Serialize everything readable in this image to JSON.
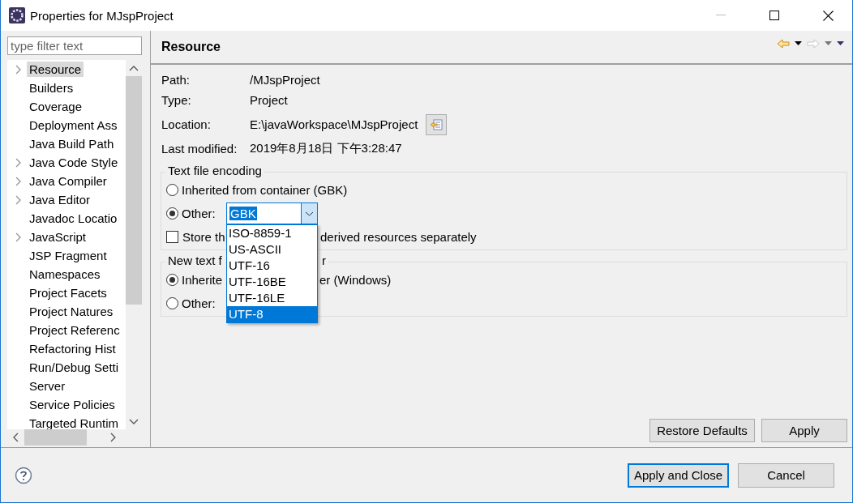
{
  "window": {
    "title": "Properties for MJspProject"
  },
  "filter": {
    "placeholder": "type filter text"
  },
  "tree": {
    "items": [
      {
        "label": "Resource",
        "expandable": true,
        "selected": true
      },
      {
        "label": "Builders",
        "expandable": false,
        "selected": false
      },
      {
        "label": "Coverage",
        "expandable": false,
        "selected": false
      },
      {
        "label": "Deployment Ass",
        "expandable": false,
        "selected": false
      },
      {
        "label": "Java Build Path",
        "expandable": false,
        "selected": false
      },
      {
        "label": "Java Code Style",
        "expandable": true,
        "selected": false
      },
      {
        "label": "Java Compiler",
        "expandable": true,
        "selected": false
      },
      {
        "label": "Java Editor",
        "expandable": true,
        "selected": false
      },
      {
        "label": "Javadoc Locatio",
        "expandable": false,
        "selected": false
      },
      {
        "label": "JavaScript",
        "expandable": true,
        "selected": false
      },
      {
        "label": "JSP Fragment",
        "expandable": false,
        "selected": false
      },
      {
        "label": "Namespaces",
        "expandable": false,
        "selected": false
      },
      {
        "label": "Project Facets",
        "expandable": false,
        "selected": false
      },
      {
        "label": "Project Natures",
        "expandable": false,
        "selected": false
      },
      {
        "label": "Project Referenc",
        "expandable": false,
        "selected": false
      },
      {
        "label": "Refactoring Hist",
        "expandable": false,
        "selected": false
      },
      {
        "label": "Run/Debug Setti",
        "expandable": false,
        "selected": false
      },
      {
        "label": "Server",
        "expandable": false,
        "selected": false
      },
      {
        "label": "Service Policies",
        "expandable": false,
        "selected": false
      },
      {
        "label": "Targeted Runtim",
        "expandable": false,
        "selected": false
      }
    ]
  },
  "page": {
    "title": "Resource",
    "properties": [
      {
        "label": "Path:",
        "value": "/MJspProject"
      },
      {
        "label": "Type:",
        "value": "Project"
      },
      {
        "label": "Location:",
        "value": "E:\\javaWorkspace\\MJspProject",
        "has_button": true
      },
      {
        "label": "Last modified:",
        "value": "2019年8月18日 下午3:28:47"
      }
    ],
    "text_file_encoding": {
      "title": "Text file encoding",
      "inherited": {
        "label": "Inherited from container (GBK)",
        "selected": false
      },
      "other": {
        "label": "Other:",
        "selected": true,
        "value": "GBK",
        "dropdown_open": true,
        "options": [
          {
            "label": "ISO-8859-1",
            "selected": false
          },
          {
            "label": "US-ASCII",
            "selected": false
          },
          {
            "label": "UTF-16",
            "selected": false
          },
          {
            "label": "UTF-16BE",
            "selected": false
          },
          {
            "label": "UTF-16LE",
            "selected": false
          },
          {
            "label": "UTF-8",
            "selected": true
          }
        ]
      },
      "store_checkbox": {
        "label_parts": [
          "Store th",
          "derived resources separately"
        ],
        "checked": false
      }
    },
    "group_2": {
      "title_parts": [
        "New text f",
        "r"
      ],
      "inherited": {
        "label_parts": [
          "Inherite",
          "er (Windows)"
        ],
        "selected": true
      },
      "other": {
        "label": "Other:",
        "selected": false
      }
    },
    "buttons": [
      {
        "label": "Restore Defaults"
      },
      {
        "label": "Apply"
      }
    ]
  },
  "footer": {
    "buttons": [
      {
        "label": "Apply and Close",
        "default": true
      },
      {
        "label": "Cancel",
        "default": false
      }
    ]
  }
}
